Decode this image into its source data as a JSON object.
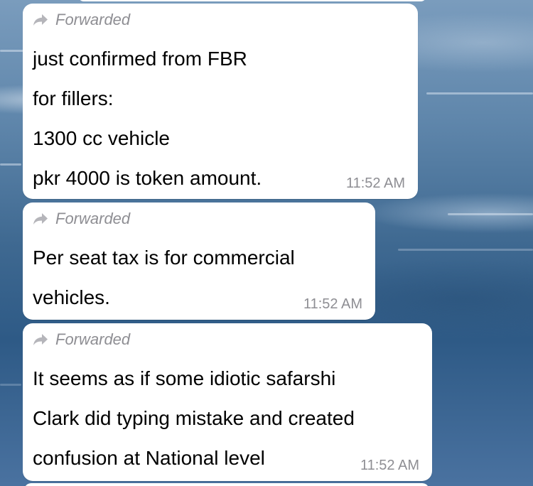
{
  "messages": [
    {
      "forwarded_label": "Forwarded",
      "lines": [
        "just confirmed from FBR",
        "for fillers:",
        "1300 cc vehicle",
        "pkr 4000 is token amount."
      ],
      "time": "11:52 AM"
    },
    {
      "forwarded_label": "Forwarded",
      "lines": [
        "Per seat tax is for commercial",
        "vehicles."
      ],
      "time": "11:52 AM"
    },
    {
      "forwarded_label": "Forwarded",
      "lines": [
        "It seems as if some idiotic safarshi",
        "Clark did typing mistake and created",
        "confusion at National level"
      ],
      "time": "11:52 AM"
    }
  ],
  "icons": {
    "forward": "forward-arrow-icon"
  },
  "colors": {
    "bubble": "#ffffff",
    "meta_text": "#8e8e93",
    "message_text": "#000000"
  }
}
